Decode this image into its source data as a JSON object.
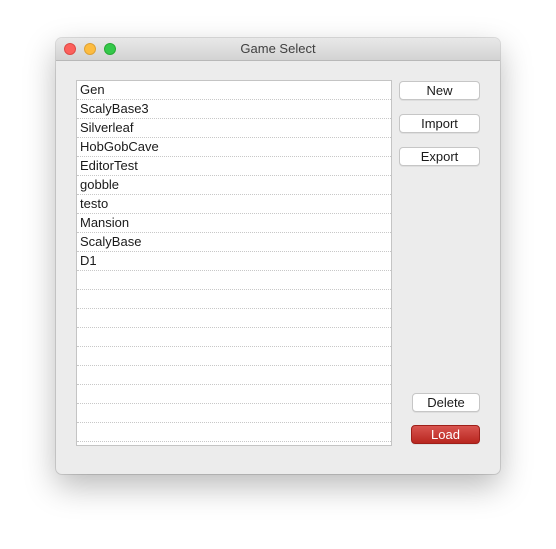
{
  "window": {
    "title": "Game Select",
    "traffic_lights": [
      "close",
      "minimize",
      "zoom"
    ]
  },
  "games": {
    "items": [
      "Gen",
      "ScalyBase3",
      "Silverleaf",
      "HobGobCave",
      "EditorTest",
      "gobble",
      "testo",
      "Mansion",
      "ScalyBase",
      "D1"
    ],
    "empty_rows": 9
  },
  "buttons": {
    "new": "New",
    "import": "Import",
    "export": "Export",
    "delete": "Delete",
    "load": "Load"
  },
  "colors": {
    "load_button": "#c8322c",
    "close": "#fc605c",
    "minimize": "#fdbc40",
    "zoom": "#34c84a"
  }
}
